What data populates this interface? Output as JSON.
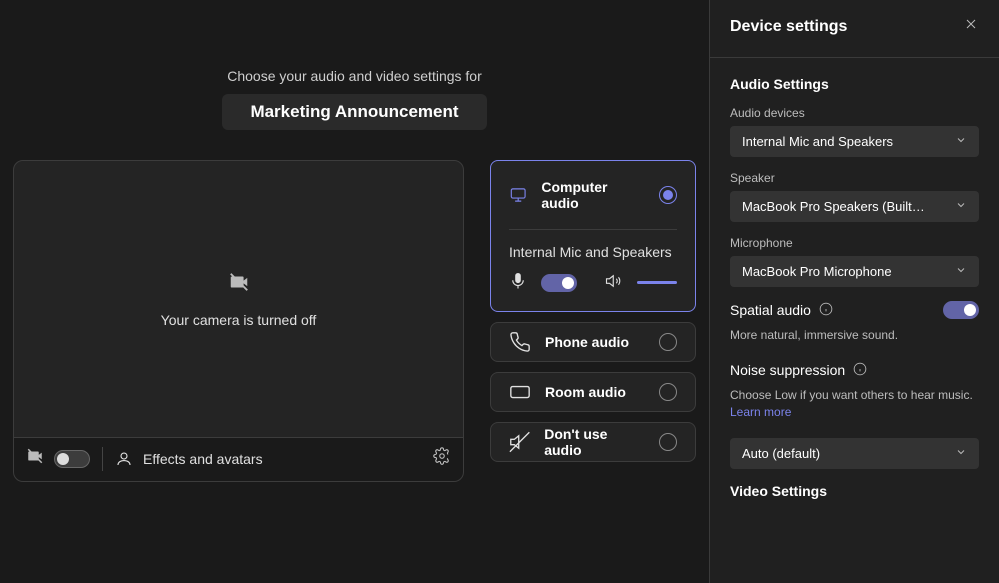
{
  "header": {
    "choose_text": "Choose your audio and video settings for",
    "meeting_title": "Marketing Announcement"
  },
  "video": {
    "camera_off_text": "Your camera is turned off",
    "effects_label": "Effects and avatars"
  },
  "audio_options": {
    "computer": "Computer audio",
    "device_line": "Internal Mic and Speakers",
    "phone": "Phone audio",
    "room": "Room audio",
    "none": "Don't use audio"
  },
  "right": {
    "title": "Device settings",
    "audio_settings_title": "Audio Settings",
    "audio_devices_label": "Audio devices",
    "audio_devices_value": "Internal Mic and Speakers",
    "speaker_label": "Speaker",
    "speaker_value": "MacBook Pro Speakers (Built…",
    "mic_label": "Microphone",
    "mic_value": "MacBook Pro Microphone",
    "spatial_label": "Spatial audio",
    "spatial_hint": "More natural, immersive sound.",
    "noise_label": "Noise suppression",
    "noise_hint": "Choose Low if you want others to hear music. ",
    "learn_more": "Learn more",
    "noise_value": "Auto (default)",
    "video_settings_title": "Video Settings"
  }
}
